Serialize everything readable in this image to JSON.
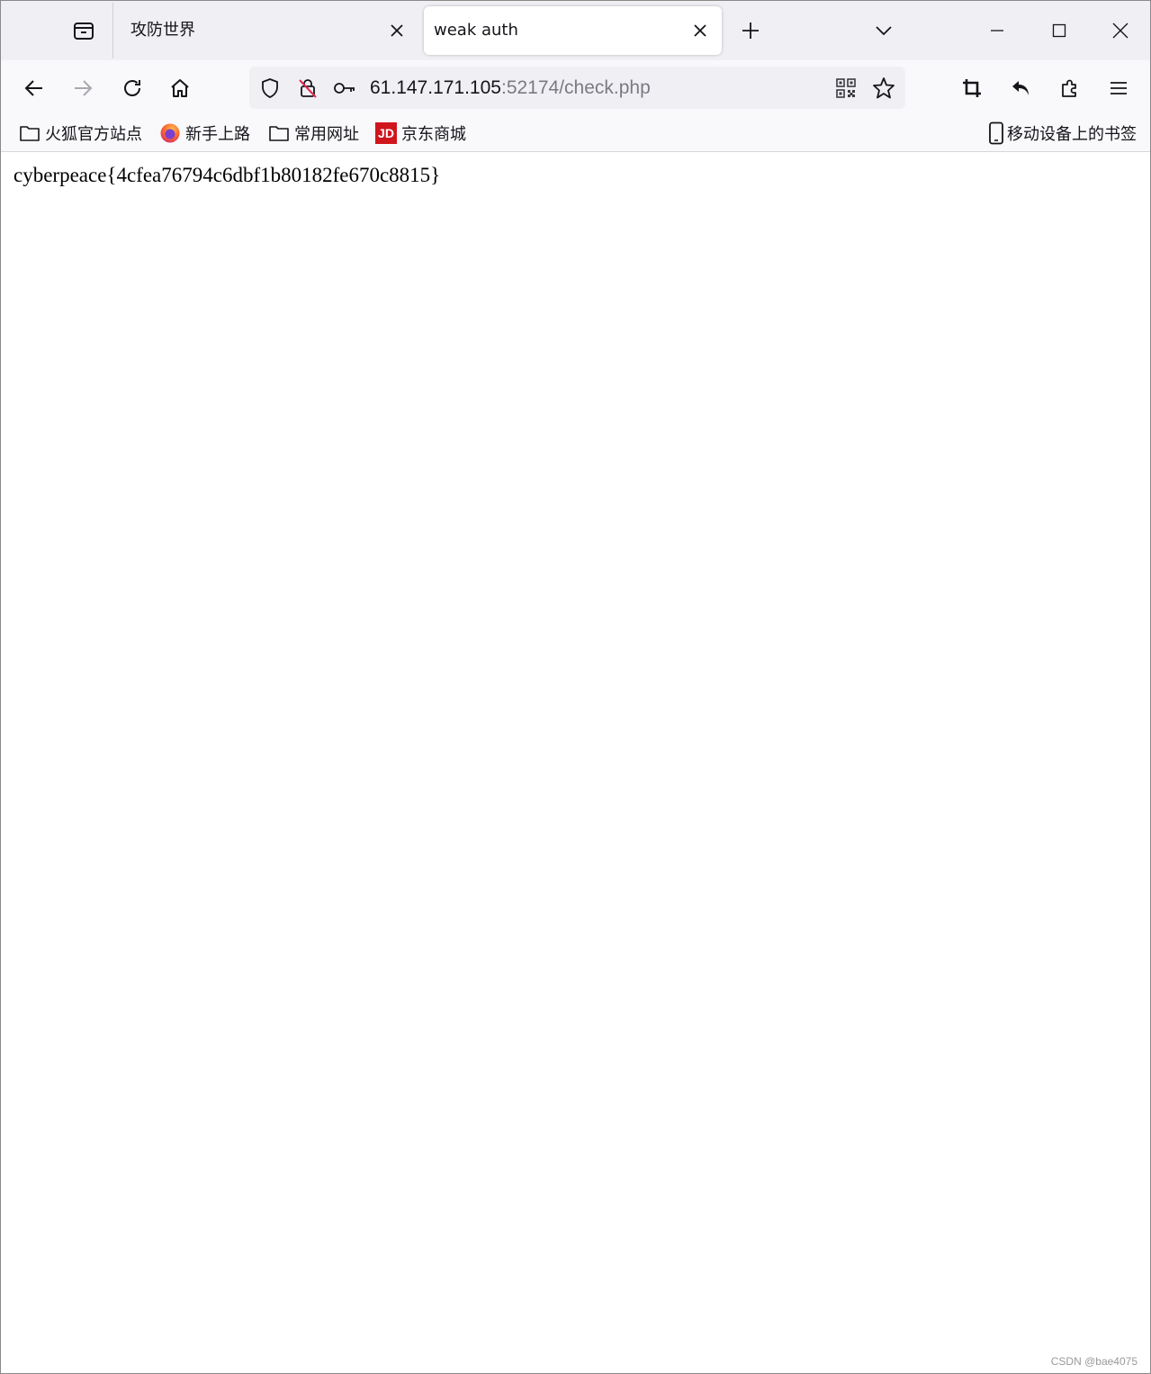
{
  "tabs": [
    {
      "title": "攻防世界",
      "active": false
    },
    {
      "title": "weak auth",
      "active": true
    }
  ],
  "urlbar": {
    "host": "61.147.171.105",
    "rest": ":52174/check.php"
  },
  "bookmarks": [
    {
      "label": "火狐官方站点",
      "icon": "folder-icon"
    },
    {
      "label": "新手上路",
      "icon": "firefox-icon"
    },
    {
      "label": "常用网址",
      "icon": "folder-icon"
    },
    {
      "label": "京东商城",
      "icon": "jd-icon",
      "icon_text": "JD"
    }
  ],
  "mobile_bookmarks": "移动设备上的书签",
  "page": {
    "text": "cyberpeace{4cfea76794c6dbf1b80182fe670c8815}"
  },
  "watermark": "CSDN @bae4075",
  "colors": {
    "tabstrip": "#f0f0f4",
    "toolbar": "#f9f9fb",
    "jd_red": "#d0161d"
  }
}
